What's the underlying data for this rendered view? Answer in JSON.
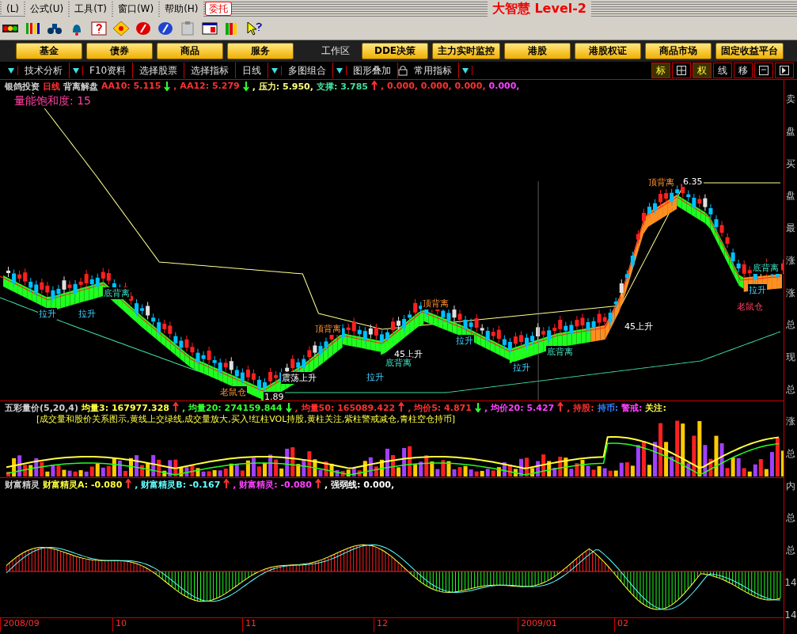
{
  "menu": [
    {
      "label": "(L)"
    },
    {
      "label": "公式(U)"
    },
    {
      "label": "工具(T)"
    },
    {
      "label": "窗口(W)"
    },
    {
      "label": "帮助(H)"
    }
  ],
  "order_button": "委托",
  "app_title": "大智慧 Level-2",
  "nav_buttons": [
    {
      "label": "基金",
      "kind": "button"
    },
    {
      "label": "债券",
      "kind": "button"
    },
    {
      "label": "商品",
      "kind": "button"
    },
    {
      "label": "服务",
      "kind": "button"
    },
    {
      "label": "工作区",
      "kind": "label"
    },
    {
      "label": "DDE决策",
      "kind": "button"
    },
    {
      "label": "主力实时监控",
      "kind": "button"
    },
    {
      "label": "港股",
      "kind": "button"
    },
    {
      "label": "港股权证",
      "kind": "button"
    },
    {
      "label": "商品市场",
      "kind": "button"
    },
    {
      "label": "固定收益平台",
      "kind": "button"
    }
  ],
  "tabs": [
    {
      "kind": "arrow"
    },
    {
      "kind": "tab",
      "label": "技术分析"
    },
    {
      "kind": "arrow"
    },
    {
      "kind": "tab",
      "label": "F10资料"
    },
    {
      "kind": "tab",
      "label": "选择股票"
    },
    {
      "kind": "tab",
      "label": "选择指标"
    },
    {
      "kind": "tab",
      "label": "日线"
    },
    {
      "kind": "arrow"
    },
    {
      "kind": "tab",
      "label": "多图组合"
    },
    {
      "kind": "arrow"
    },
    {
      "kind": "tab",
      "label": "图形叠加"
    },
    {
      "kind": "lock"
    },
    {
      "kind": "tab",
      "label": "常用指标"
    },
    {
      "kind": "arrow"
    }
  ],
  "right_tools": [
    {
      "kind": "text",
      "label": "标",
      "selected": true
    },
    {
      "kind": "grid"
    },
    {
      "kind": "text",
      "label": "权",
      "selected": true
    },
    {
      "kind": "text",
      "label": "线",
      "selected": false
    },
    {
      "kind": "text",
      "label": "移",
      "selected": false
    },
    {
      "kind": "window"
    },
    {
      "kind": "play"
    }
  ],
  "main_chart": {
    "header": [
      {
        "kind": "text",
        "text": "银鸽投资",
        "color": "#d0d0d0"
      },
      {
        "kind": "text",
        "text": "日线",
        "color": "#ff3030"
      },
      {
        "kind": "text",
        "text": "背离解盘",
        "color": "#d0d0d0"
      },
      {
        "kind": "text",
        "text": "AA10: 5.115",
        "color": "#ff3030"
      },
      {
        "kind": "arrow",
        "rising": false,
        "color": "#30ff30"
      },
      {
        "kind": "text",
        "text": ", AA12: 5.279",
        "color": "#ff3030"
      },
      {
        "kind": "arrow",
        "rising": false,
        "color": "#30ff30"
      },
      {
        "kind": "text",
        "text": ", 压力: 5.950,",
        "color": "#ffff80"
      },
      {
        "kind": "text",
        "text": "支撑: 3.785",
        "color": "#40e0a0"
      },
      {
        "kind": "arrow",
        "rising": true,
        "color": "#ff3030"
      },
      {
        "kind": "text",
        "text": ", 0.000, 0.000, 0.000,",
        "color": "#ff3030"
      },
      {
        "kind": "text",
        "text": "0.000,",
        "color": "#ff40ff"
      }
    ],
    "saturation": "量能饱和度: 15",
    "annotations": [
      {
        "text": "6.35",
        "kind": "price"
      },
      {
        "text": "顶背离",
        "kind": "top"
      },
      {
        "text": "顶背离",
        "kind": "top"
      },
      {
        "text": "顶背离",
        "kind": "top"
      },
      {
        "text": "底背离",
        "kind": "bottom"
      },
      {
        "text": "拉升",
        "kind": "rise"
      },
      {
        "text": "拉升",
        "kind": "rise"
      },
      {
        "text": "拉升",
        "kind": "rise"
      },
      {
        "text": "拉升",
        "kind": "rise"
      },
      {
        "text": "拉升",
        "kind": "rise"
      },
      {
        "text": "拉升",
        "kind": "rise"
      },
      {
        "text": "45上升",
        "kind": "price"
      },
      {
        "text": "45上升",
        "kind": "price"
      },
      {
        "text": "底背离",
        "kind": "bottom"
      },
      {
        "text": "底背离",
        "kind": "bottom"
      },
      {
        "text": "底背离",
        "kind": "bottom"
      },
      {
        "text": "老鼠仓",
        "kind": "rat"
      },
      {
        "text": "老鼠仓",
        "kind": "rat2"
      },
      {
        "text": "1.89",
        "kind": "price"
      },
      {
        "text": "震荡上升",
        "kind": "price"
      }
    ]
  },
  "volume_pane": {
    "header": [
      {
        "kind": "text",
        "text": "五彩量价(5,20,4)",
        "color": "#d0d0d0"
      },
      {
        "kind": "text",
        "text": "均量3: 167977.328",
        "color": "#ffff40"
      },
      {
        "kind": "arrow",
        "rising": true,
        "color": "#ff3030"
      },
      {
        "kind": "text",
        "text": ", 均量20: 274159.844",
        "color": "#30ff30"
      },
      {
        "kind": "arrow",
        "rising": false,
        "color": "#30ff30"
      },
      {
        "kind": "text",
        "text": ", 均量50: 165089.422",
        "color": "#ff3030"
      },
      {
        "kind": "arrow",
        "rising": true,
        "color": "#ff3030"
      },
      {
        "kind": "text",
        "text": ", 均价5: 4.871",
        "color": "#ff3030"
      },
      {
        "kind": "arrow",
        "rising": false,
        "color": "#30ff30"
      },
      {
        "kind": "text",
        "text": ", 均价20: 5.427",
        "color": "#ff40ff"
      },
      {
        "kind": "arrow",
        "rising": true,
        "color": "#ff3030"
      },
      {
        "kind": "text",
        "text": ", 持股:",
        "color": "#ff3030"
      },
      {
        "kind": "text",
        "text": "持币:",
        "color": "#3080ff"
      },
      {
        "kind": "text",
        "text": "警戒:",
        "color": "#ff40ff"
      },
      {
        "kind": "text",
        "text": "关注:",
        "color": "#ffff40"
      }
    ],
    "note": "[成交量和股价关系图示,黄线上交绿线,成交量放大,买入!红柱VOL持股,黄柱关注,紫柱警戒减仓,青柱空仓持币]"
  },
  "wealth_pane": {
    "header": [
      {
        "kind": "text",
        "text": "财富精灵",
        "color": "#d0d0d0"
      },
      {
        "kind": "text",
        "text": "财富精灵A: -0.080",
        "color": "#ffff40"
      },
      {
        "kind": "arrow",
        "rising": true,
        "color": "#ff3030"
      },
      {
        "kind": "text",
        "text": ", 财富精灵B: -0.167",
        "color": "#60ffff"
      },
      {
        "kind": "arrow",
        "rising": true,
        "color": "#ff3030"
      },
      {
        "kind": "text",
        "text": ", 财富精灵: -0.080",
        "color": "#ff40ff"
      },
      {
        "kind": "arrow",
        "rising": true,
        "color": "#ff3030"
      },
      {
        "kind": "text",
        "text": ", 强弱线: 0.000,",
        "color": "#ffffff"
      }
    ]
  },
  "date_axis": [
    "2008/09",
    "10",
    "11",
    "12",
    "2009/01",
    "02"
  ],
  "side_panel": [
    "卖",
    "盘",
    "买",
    "盘",
    "最",
    "涨",
    "涨",
    "总",
    "现",
    "总",
    "涨",
    "总",
    "内",
    "总",
    "总",
    "14",
    "14"
  ]
}
